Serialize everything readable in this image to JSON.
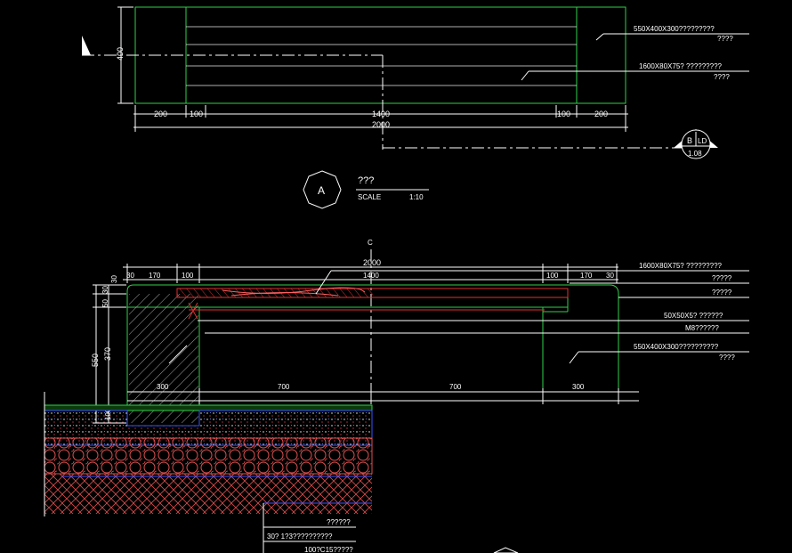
{
  "plan": {
    "height_dim": "400",
    "dims_top": [
      "200",
      "100",
      "1400",
      "100",
      "200"
    ],
    "dim_total": "2000",
    "callout_1_line1": "550X400X300?????????",
    "callout_1_line2": "????",
    "callout_2_line1": "1600X80X75? ?????????",
    "callout_2_line2": "????",
    "section_marker_letter": "B",
    "section_marker_ref": "LD",
    "section_marker_sheet": "1.08"
  },
  "title_block": {
    "letter": "A",
    "name": "???",
    "scale_label": "SCALE",
    "scale_value": "1:10"
  },
  "section": {
    "centerline_symbol": "C",
    "dim_total": "2000",
    "dims_top": [
      "30",
      "170",
      "100",
      "1400",
      "100",
      "170",
      "30"
    ],
    "dims_left": [
      "30",
      "50",
      "30",
      "550",
      "370",
      "100"
    ],
    "dims_bottom": [
      "300",
      "700",
      "700",
      "300"
    ],
    "callouts": [
      "1600X80X75? ?????????",
      "?????",
      "?????",
      "50X50X5? ??????",
      "M8??????",
      "550X400X300??????????",
      "????"
    ],
    "notes": [
      "??????",
      "30? 1?3??????????",
      "100?C15?????"
    ]
  },
  "colors": {
    "background": "#000000",
    "outline": "#2fd04a",
    "red": "#e03030",
    "blue": "#3a52ff",
    "text": "#ffffff",
    "gravel": "#e05050"
  }
}
